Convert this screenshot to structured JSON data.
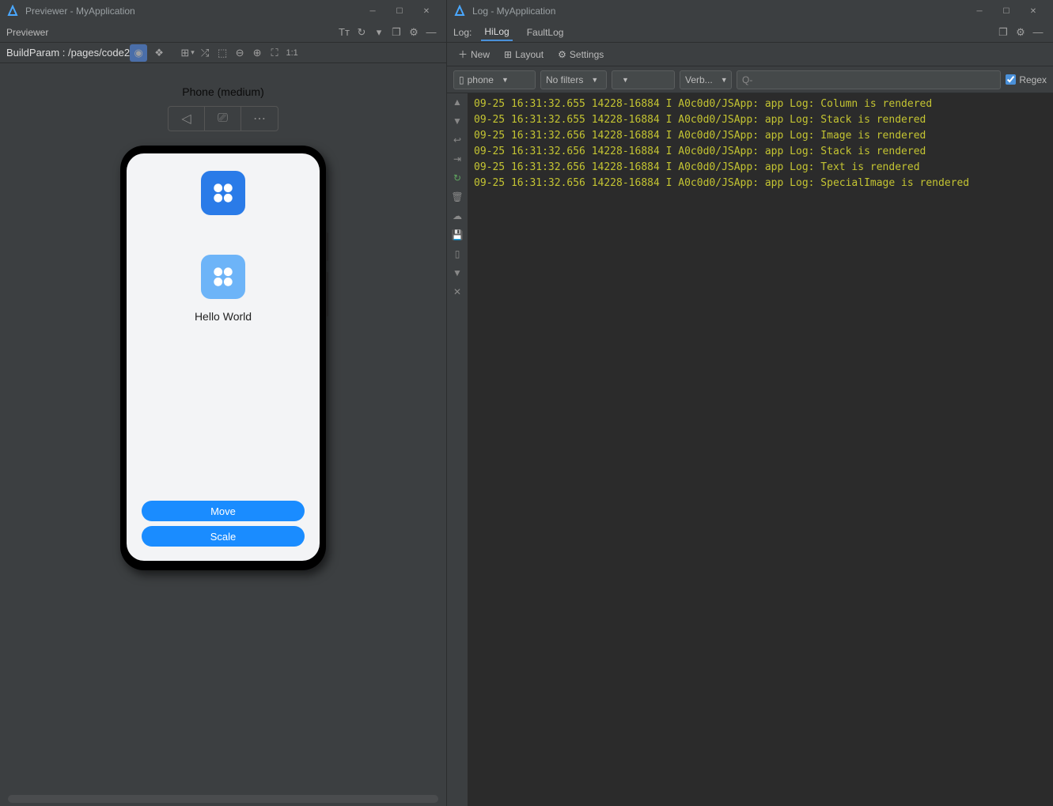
{
  "left": {
    "title": "Previewer - MyApplication",
    "panel_label": "Previewer",
    "build_param": "BuildParam : /pages/code2",
    "device_label": "Phone (medium)",
    "hello_text": "Hello World",
    "button_move": "Move",
    "button_scale": "Scale"
  },
  "right": {
    "title": "Log - MyApplication",
    "log_label": "Log:",
    "tabs": {
      "hilog": "HiLog",
      "faultlog": "FaultLog"
    },
    "actions": {
      "new": "New",
      "layout": "Layout",
      "settings": "Settings"
    },
    "filters": {
      "device": "phone",
      "filter": "No filters",
      "level": "Verb...",
      "search_placeholder": "Q-",
      "regex": "Regex"
    },
    "log_lines": [
      "09-25 16:31:32.655 14228-16884 I A0c0d0/JSApp: app Log: Column is rendered",
      "09-25 16:31:32.655 14228-16884 I A0c0d0/JSApp: app Log: Stack is rendered",
      "09-25 16:31:32.656 14228-16884 I A0c0d0/JSApp: app Log: Image is rendered",
      "09-25 16:31:32.656 14228-16884 I A0c0d0/JSApp: app Log: Stack is rendered",
      "09-25 16:31:32.656 14228-16884 I A0c0d0/JSApp: app Log: Text is rendered",
      "09-25 16:31:32.656 14228-16884 I A0c0d0/JSApp: app Log: SpecialImage is rendered"
    ]
  }
}
